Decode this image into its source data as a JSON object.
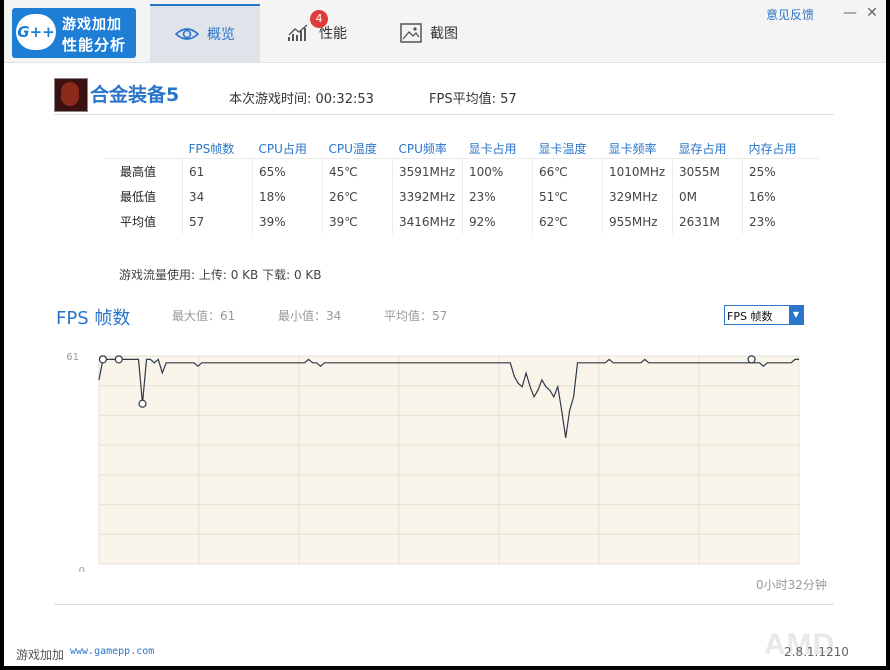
{
  "app": {
    "logo_badge": "G++",
    "logo_line1": "游戏加加",
    "logo_line2": "性能分析",
    "feedback": "意见反馈",
    "minimize": "—",
    "close": "✕"
  },
  "tabs": [
    {
      "label": "概览",
      "icon": "eye-icon"
    },
    {
      "label": "性能",
      "icon": "chart-icon"
    },
    {
      "label": "截图",
      "icon": "image-icon",
      "badge": "4"
    }
  ],
  "game": {
    "title": "合金装备5",
    "playtime": "本次游戏时间: 00:32:53",
    "fps_avg": "FPS平均值: 57"
  },
  "stats": {
    "headers": [
      "FPS帧数",
      "CPU占用",
      "CPU温度",
      "CPU频率",
      "显卡占用",
      "显卡温度",
      "显卡频率",
      "显存占用",
      "内存占用"
    ],
    "rows": [
      {
        "label": "最高值",
        "cells": [
          "61",
          "65%",
          "45℃",
          "3591MHz",
          "100%",
          "66℃",
          "1010MHz",
          "3055M",
          "25%"
        ]
      },
      {
        "label": "最低值",
        "cells": [
          "34",
          "18%",
          "26℃",
          "3392MHz",
          "23%",
          "51℃",
          "329MHz",
          "0M",
          "16%"
        ]
      },
      {
        "label": "平均值",
        "cells": [
          "57",
          "39%",
          "39℃",
          "3416MHz",
          "92%",
          "62℃",
          "955MHz",
          "2631M",
          "23%"
        ]
      }
    ]
  },
  "traffic": "游戏流量使用: 上传: 0 KB   下载: 0 KB",
  "chart_header": {
    "title": "FPS 帧数",
    "max": "最大值：61",
    "min": "最小值：34",
    "avg": "平均值：57",
    "select_value": "FPS 帧数"
  },
  "chart_data": {
    "type": "line",
    "ylim": [
      0,
      61
    ],
    "y_ticks": [
      "61",
      "0"
    ],
    "series": [
      {
        "values": [
          54,
          60,
          60,
          60,
          60,
          60,
          60,
          60,
          60,
          60,
          60,
          47,
          60,
          60,
          59,
          60,
          56,
          59,
          59,
          59,
          59,
          59,
          59,
          59,
          59,
          58,
          59,
          59,
          59,
          59,
          59,
          59,
          59,
          59,
          59,
          59,
          59,
          59,
          59,
          59,
          59,
          59,
          59,
          59,
          59,
          59,
          59,
          59,
          59,
          59,
          59,
          59,
          59,
          60,
          59,
          59,
          58,
          59,
          59,
          59,
          59,
          59,
          59,
          59,
          59,
          59,
          59,
          59,
          59,
          59,
          59,
          59,
          59,
          59,
          59,
          59,
          59,
          59,
          59,
          59,
          59,
          59,
          59,
          59,
          59,
          59,
          59,
          59,
          59,
          59,
          59,
          59,
          59,
          59,
          59,
          59,
          59,
          59,
          59,
          59,
          59,
          59,
          59,
          59,
          59,
          55,
          53,
          52,
          56,
          52,
          49,
          51,
          54,
          52,
          51,
          49,
          52,
          45,
          37,
          45,
          49,
          59,
          59,
          59,
          59,
          59,
          59,
          59,
          59,
          60,
          59,
          59,
          59,
          59,
          59,
          59,
          59,
          59,
          60,
          59,
          59,
          59,
          59,
          59,
          59,
          59,
          59,
          59,
          59,
          59,
          59,
          59,
          59,
          59,
          59,
          59,
          59,
          59,
          59,
          59,
          59,
          59,
          59,
          59,
          59,
          59,
          59,
          59,
          58,
          59,
          59,
          59,
          59,
          59,
          59,
          59,
          60,
          60
        ]
      }
    ],
    "markers": [
      {
        "index": 1,
        "value": 60
      },
      {
        "index": 5,
        "value": 60
      },
      {
        "index": 11,
        "value": 47
      },
      {
        "index": 165,
        "value": 60
      }
    ],
    "grid": true,
    "duration_label": "0小时32分钟"
  },
  "footer": {
    "brand": "游戏加加",
    "url": "www.gamepp.com",
    "version": "2.8.1.1210",
    "amd": "AMD"
  }
}
